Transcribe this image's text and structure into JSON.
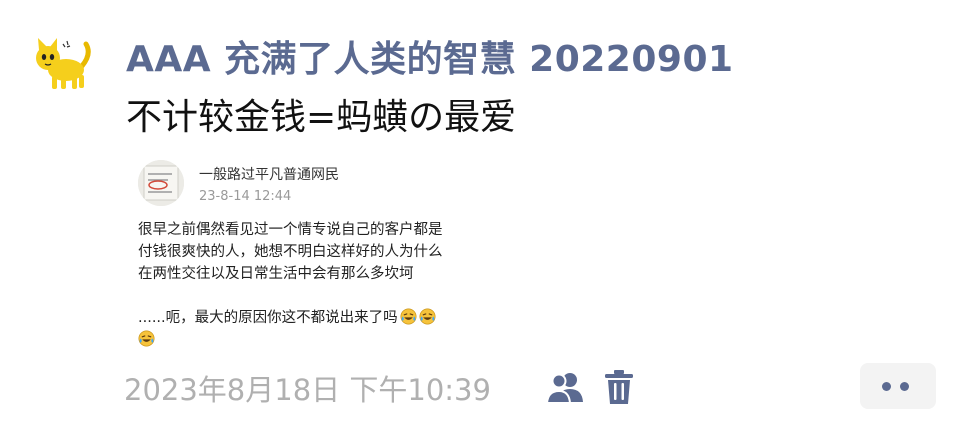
{
  "post": {
    "author": "AAA 充满了人类的智慧 20220901",
    "text": "不计较金钱=蚂蟥の最爱",
    "quoted": {
      "name": "一般路过平凡普通网民",
      "time": "23-8-14 12:44",
      "lines": [
        "很早之前偶然看见过一个情专说自己的客户都是",
        "付钱很爽快的人，她想不明白这样好的人为什么",
        "在两性交往以及日常生活中会有那么多坎坷",
        "",
        "......呃，最大的原因你这不都说出来了吗"
      ],
      "emoji": "laughing-tears-emoji"
    },
    "timestamp": "2023年8月18日 下午10:39"
  },
  "icons": {
    "avatar": "yellow-cat-avatar",
    "people": "people-icon",
    "trash": "trash-icon",
    "more": "more-dots-icon"
  },
  "colors": {
    "name": "#5b6a91",
    "text": "#111111",
    "timestamp": "#b0b0b0",
    "more_bg": "#f3f3f3",
    "emoji_face": "#f6c33b"
  }
}
